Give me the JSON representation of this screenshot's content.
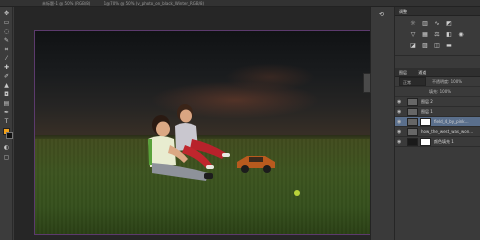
{
  "window": {
    "tabs": [
      "未标题-1 @ 50% (RGB/8)",
      "1@70% @ 50% (v_photo_on_black_Winter_RGB/8)"
    ]
  },
  "toolbar": {
    "icons": [
      "move-icon",
      "marquee-icon",
      "lasso-icon",
      "quick-select-icon",
      "crop-icon",
      "eyedropper-icon",
      "healing-icon",
      "brush-icon",
      "stamp-icon",
      "history-brush-icon",
      "eraser-icon",
      "gradient-icon",
      "blur-icon",
      "dodge-icon",
      "pen-icon",
      "type-icon",
      "path-select-icon",
      "shape-icon",
      "hand-icon",
      "zoom-icon"
    ],
    "foreground_color": "#f3a21b",
    "background_color": "#111111"
  },
  "panels": {
    "adjustments_tab": "调整",
    "layers_tab": "图层",
    "channels_tab": "通道",
    "blend_mode": "正常",
    "opacity_label": "不透明度: 100%",
    "fill_label": "填充: 100%",
    "layers": [
      {
        "name": "图层 2",
        "active": false,
        "has_mask": false
      },
      {
        "name": "图层 1",
        "active": false,
        "has_mask": false
      },
      {
        "name": "field_4_by_pink…",
        "active": true,
        "has_mask": true
      },
      {
        "name": "how_the_west_was_won…",
        "active": false,
        "has_mask": false
      },
      {
        "name": "颜色填充 1",
        "active": false,
        "has_mask": true
      }
    ]
  },
  "colors": {
    "accent": "#5a6f8c",
    "document_border": "#5c3a6d"
  }
}
